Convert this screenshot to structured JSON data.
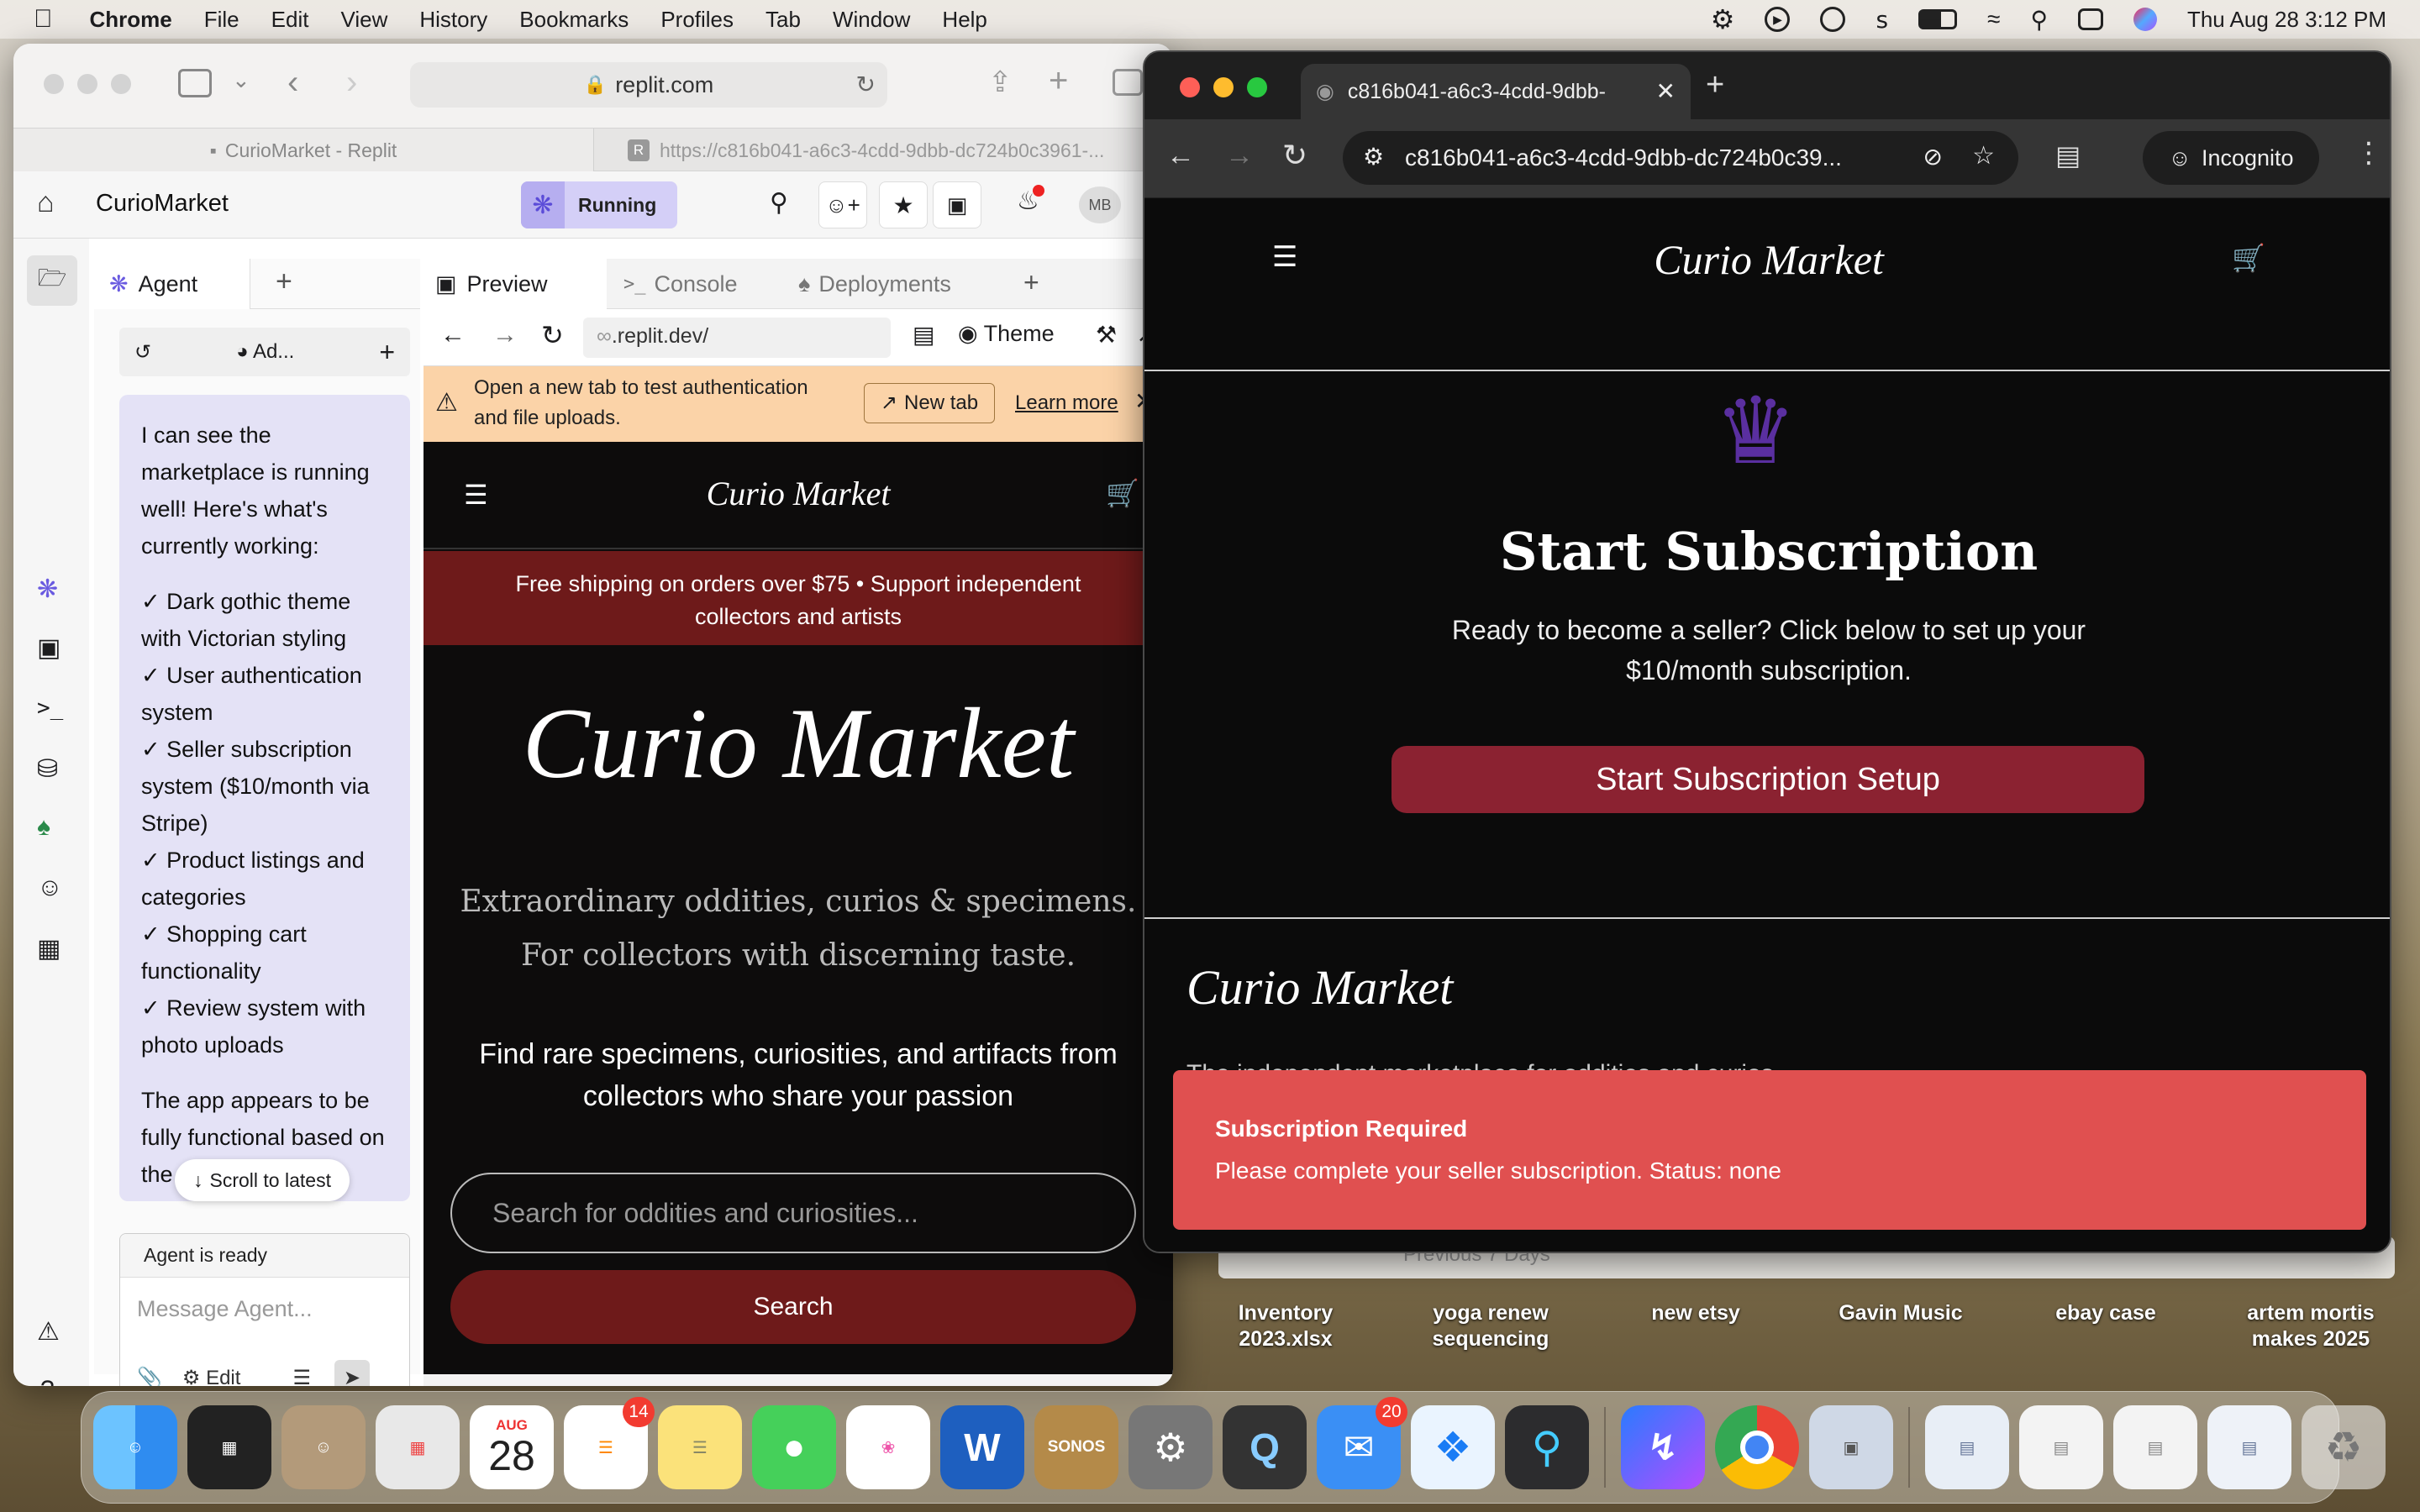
{
  "menubar": {
    "app": "Chrome",
    "items": [
      "File",
      "Edit",
      "View",
      "History",
      "Bookmarks",
      "Profiles",
      "Tab",
      "Window",
      "Help"
    ],
    "datetime": "Thu Aug 28  3:12 PM"
  },
  "desktop_files": [
    {
      "line1": "Inventory",
      "line2": "2023.xlsx"
    },
    {
      "line1": "yoga renew",
      "line2": "sequencing"
    },
    {
      "line1": "new etsy",
      "line2": ""
    },
    {
      "line1": "Gavin Music",
      "line2": ""
    },
    {
      "line1": "ebay case",
      "line2": ""
    },
    {
      "line1": "artem mortis",
      "line2": "makes 2025"
    }
  ],
  "desktop_partial": "Previous 7 Days",
  "dock": {
    "calendar_month": "AUG",
    "calendar_day": "28",
    "reminders_badge": "14",
    "mail_badge": "20",
    "sonos": "SONOS"
  },
  "safari": {
    "url": "replit.com",
    "tab1": "CurioMarket - Replit",
    "tab2": "https://c816b041-a6c3-4cdd-9dbb-dc724b0c3961-...",
    "replit": {
      "project": "CurioMarket",
      "running": "Running",
      "avatar": "MB",
      "agent_tab": "Agent",
      "agent_mode": "Ad...",
      "message_intro": "I can see the marketplace is running well! Here's what's currently working:",
      "checklist": [
        "✓ Dark gothic theme with Victorian styling",
        "✓ User authentication system",
        "✓ Seller subscription system ($10/month via Stripe)",
        "✓ Product listings and categories",
        "✓ Shopping cart functionality",
        "✓ Review system with photo uploads"
      ],
      "message_trail": "The app appears to be fully functional based on the server logs",
      "scroll_latest": "Scroll to latest",
      "agent_status": "Agent is ready",
      "message_placeholder": "Message Agent...",
      "edit": "Edit",
      "pane_tabs": [
        "Preview",
        "Console",
        "Deployments"
      ],
      "preview_url": ".replit.dev/",
      "theme": "Theme",
      "warning": "Open a new tab to test authentication and file uploads.",
      "new_tab": "New tab",
      "learn_more": "Learn more"
    },
    "site": {
      "logo": "Curio Market",
      "banner": "Free shipping on orders over $75 • Support independent collectors and artists",
      "hero_title": "Curio Market",
      "tagline1": "Extraordinary oddities, curios & specimens.",
      "tagline2": "For collectors with discerning taste.",
      "subtitle": "Find rare specimens, curiosities, and artifacts from collectors who share your passion",
      "search_placeholder": "Search for oddities and curiosities...",
      "search_button": "Search"
    }
  },
  "chrome": {
    "tab_title": "c816b041-a6c3-4cdd-9dbb-",
    "url": "c816b041-a6c3-4cdd-9dbb-dc724b0c39...",
    "incognito": "Incognito",
    "logo": "Curio Market",
    "heading": "Start Subscription",
    "description": "Ready to become a seller? Click below to set up your $10/month subscription.",
    "cta": "Start Subscription Setup",
    "footer_logo": "Curio Market",
    "footer_text": "The independent marketplace for oddities and curios",
    "toast_title": "Subscription Required",
    "toast_body": "Please complete your seller subscription. Status: none"
  },
  "colors": {
    "maroon": "#8b2231",
    "banner": "#6e1a1a",
    "purple": "#5a2fa0",
    "toast": "#e05050",
    "replit_accent": "#d4cff7"
  }
}
